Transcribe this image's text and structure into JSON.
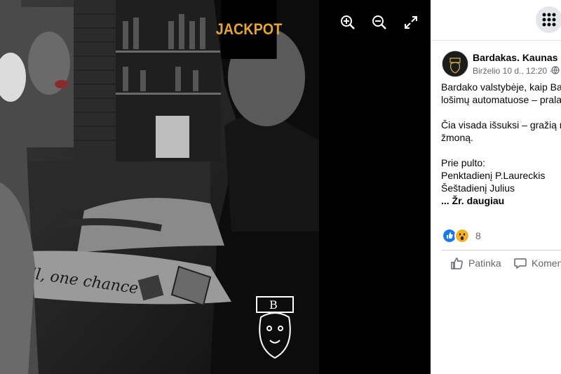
{
  "viewer": {
    "censor_label": "JACKPOT",
    "controls": [
      {
        "name": "zoom-in",
        "icon": "zoom-in-icon"
      },
      {
        "name": "zoom-out",
        "icon": "zoom-out-icon"
      },
      {
        "name": "fullscreen",
        "icon": "expand-icon"
      }
    ],
    "tattoo_text": "... all, one chance"
  },
  "panel": {
    "menu_icon": "grid-menu-icon",
    "page_name": "Bardakas. Kaunas",
    "date": "Birželio 10 d., 12:20 ·",
    "privacy_icon": "globe-icon",
    "body_lines": [
      "Bardako valstybėje, kaip Bas",
      "lošimų automatuose – prala",
      "",
      "Čia visada išsuksi – gražią m",
      "žmoną.",
      "",
      "Prie pulto:",
      "Penktadienį P.Laureckis",
      "Šeštadienį Julius"
    ],
    "see_more": "... Žr. daugiau",
    "reaction_count": "8",
    "reaction_icons": [
      "like-reaction-icon",
      "wow-reaction-icon"
    ],
    "actions": {
      "like": "Patinka",
      "comment": "Komen"
    },
    "colors": {
      "accent": "#1877f2",
      "secondary_text": "#65676b",
      "censor": "#e4a33a"
    }
  }
}
